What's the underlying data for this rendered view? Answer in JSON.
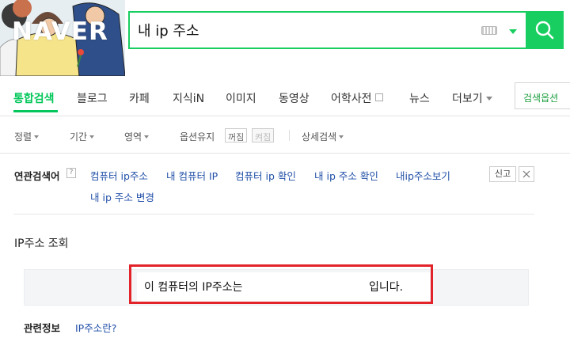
{
  "header": {
    "logo_text": "NAVER",
    "search_value": "내 ip 주소",
    "accent_color": "#19ce60"
  },
  "tabs": [
    {
      "label": "통합검색",
      "active": true
    },
    {
      "label": "블로그"
    },
    {
      "label": "카페"
    },
    {
      "label": "지식iN"
    },
    {
      "label": "이미지"
    },
    {
      "label": "동영상"
    },
    {
      "label": "어학사전"
    },
    {
      "label": "뉴스"
    },
    {
      "label": "더보기"
    }
  ],
  "search_options_label": "검색옵션",
  "filters": {
    "sort": "정렬",
    "period": "기간",
    "area": "영역",
    "keep_options": "옵션유지",
    "toggle_on": "꺼짐",
    "toggle_off": "켜짐",
    "detail_search": "상세검색"
  },
  "related_searches": {
    "title": "연관검색어",
    "help": "?",
    "items": [
      "컴퓨터 ip주소",
      "내 컴퓨터 IP",
      "컴퓨터 ip 확인",
      "내 ip 주소 확인",
      "내ip주소보기",
      "내 ip 주소 변경"
    ],
    "report_label": "신고"
  },
  "ip_lookup": {
    "title": "IP주소 조회",
    "prefix": "이 컴퓨터의 IP주소는",
    "suffix": "입니다.",
    "related_info_label": "관련정보",
    "related_info_link": "IP주소란?",
    "highlight_color": "#e2232a"
  }
}
